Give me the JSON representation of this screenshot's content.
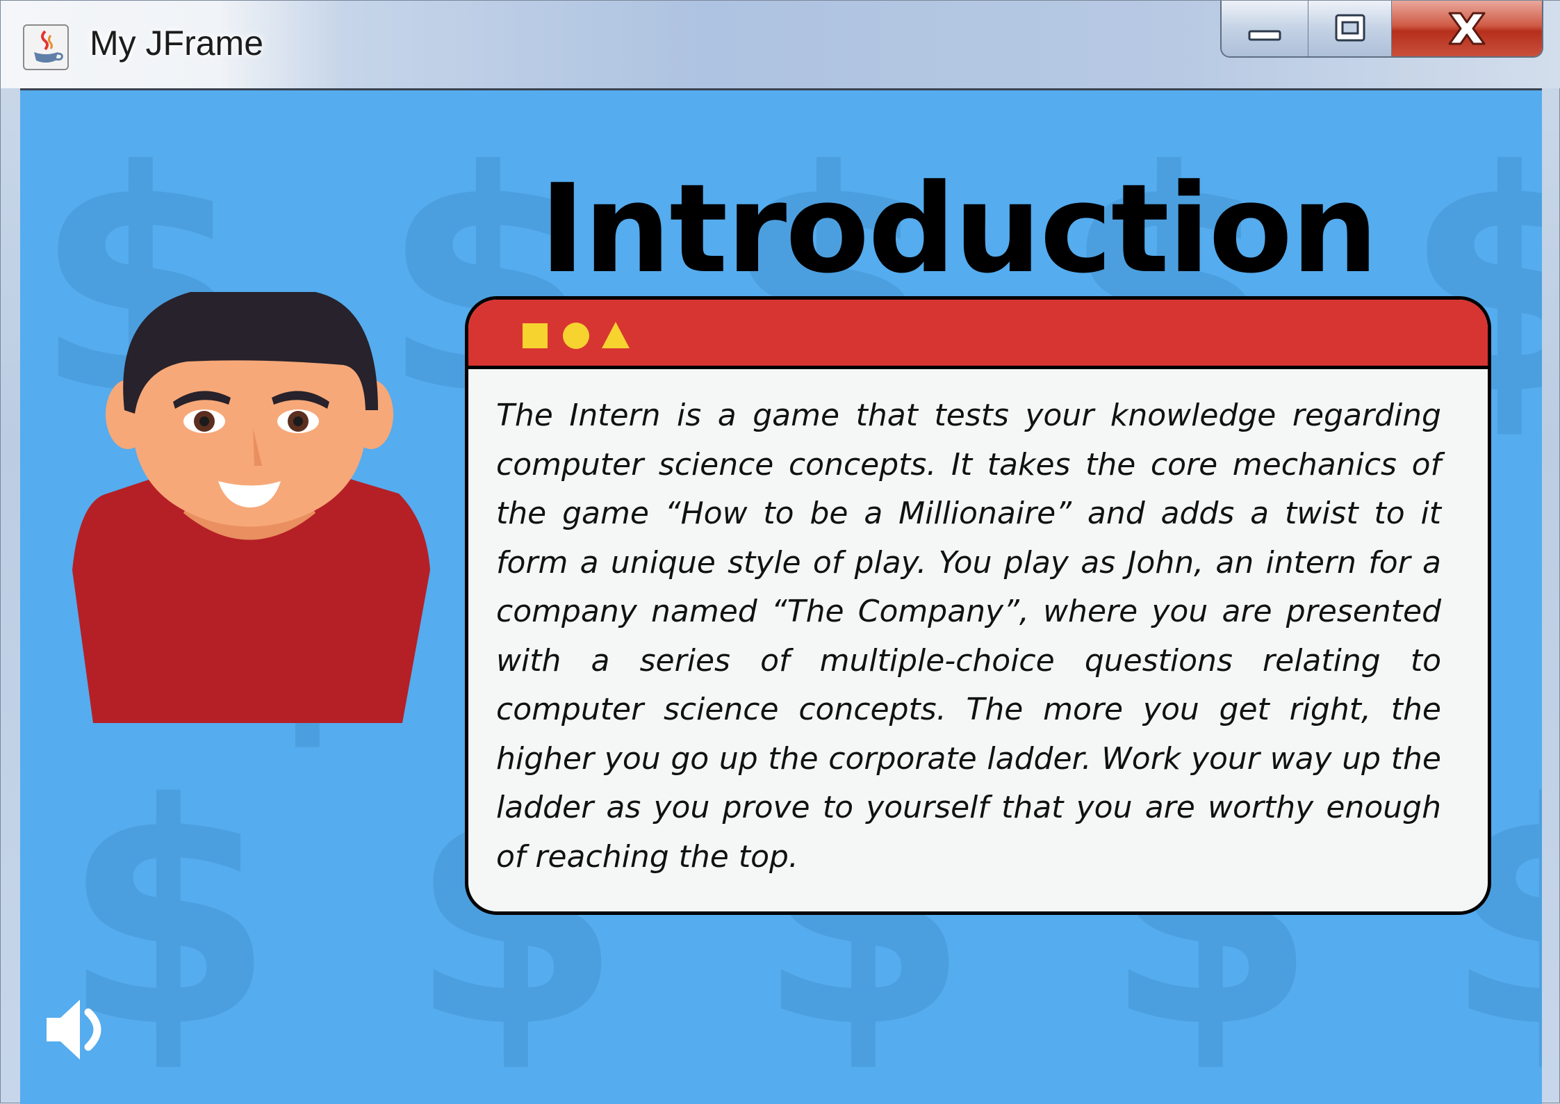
{
  "window": {
    "title": "My JFrame",
    "icons": {
      "app": "java-cup-icon",
      "minimize": "minimize-icon",
      "maximize": "maximize-icon",
      "close": "close-icon"
    }
  },
  "intro": {
    "heading": "Introduction",
    "card_shapes": [
      "square-icon",
      "circle-icon",
      "triangle-icon"
    ],
    "body": "The Intern is a game that tests your knowledge regarding computer science concepts. It takes the core mechanics of the game “How to be a Millionaire” and adds a twist to it form a unique style of play. You play as John, an intern for a company named “The Company”, where you are presented with a series of multiple-choice questions relating to computer science concepts. The more you get right, the higher you go up the corporate ladder. Work your way up the ladder as you prove to yourself that you are worthy enough of reaching the top."
  },
  "controls": {
    "sound_icon": "speaker-icon"
  },
  "colors": {
    "background": "#55acee",
    "card_header": "#d73532",
    "card_body": "#f5f6f6",
    "accent_shapes": "#f7d330",
    "shirt": "#b52026",
    "skin": "#f7a878",
    "hair": "#27222b"
  }
}
